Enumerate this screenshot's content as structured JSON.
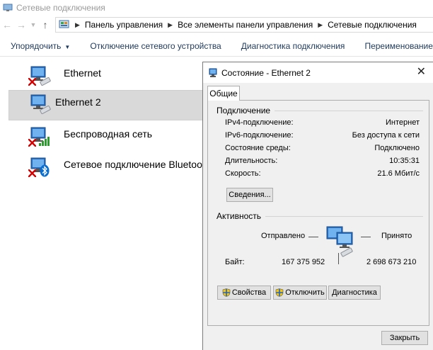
{
  "window": {
    "title": "Сетевые подключения"
  },
  "address": {
    "crumbs": [
      "Панель управления",
      "Все элементы панели управления",
      "Сетевые подключения"
    ]
  },
  "toolbar": {
    "organize": "Упорядочить",
    "disable": "Отключение сетевого устройства",
    "diagnose": "Диагностика подключения",
    "rename": "Переименование подключения"
  },
  "connections": [
    {
      "label": "Ethernet",
      "status_icon": "red-x-icon",
      "selected": false
    },
    {
      "label": "Ethernet 2",
      "status_icon": "network-cable-icon",
      "selected": true
    },
    {
      "label": "Беспроводная сеть",
      "status_icon": "wifi-signal-icon",
      "selected": false
    },
    {
      "label": "Сетевое подключение Bluetooth",
      "status_icon": "bluetooth-icon",
      "selected": false
    }
  ],
  "dialog": {
    "title": "Состояние - Ethernet 2",
    "tab": "Общие",
    "connection": {
      "title": "Подключение",
      "rows": [
        {
          "label": "IPv4-подключение:",
          "value": "Интернет"
        },
        {
          "label": "IPv6-подключение:",
          "value": "Без доступа к сети"
        },
        {
          "label": "Состояние среды:",
          "value": "Подключено"
        },
        {
          "label": "Длительность:",
          "value": "10:35:31"
        },
        {
          "label": "Скорость:",
          "value": "21.6 Мбит/с"
        }
      ],
      "details_button": "Сведения..."
    },
    "activity": {
      "title": "Активность",
      "sent_label": "Отправлено",
      "received_label": "Принято",
      "bytes_label": "Байт:",
      "bytes_sent": "167 375 952",
      "bytes_received": "2 698 673 210"
    },
    "buttons": {
      "properties": "Свойства",
      "disable": "Отключить",
      "diagnose": "Диагностика",
      "close": "Закрыть"
    }
  },
  "colors": {
    "toolbar_text": "#1e395b",
    "selection": "#d9d9d9",
    "dialog_bg": "#f0f0f0",
    "red_x": "#d40000",
    "signal_green": "#2e9b2e",
    "bluetooth_blue": "#0a6ed1"
  }
}
